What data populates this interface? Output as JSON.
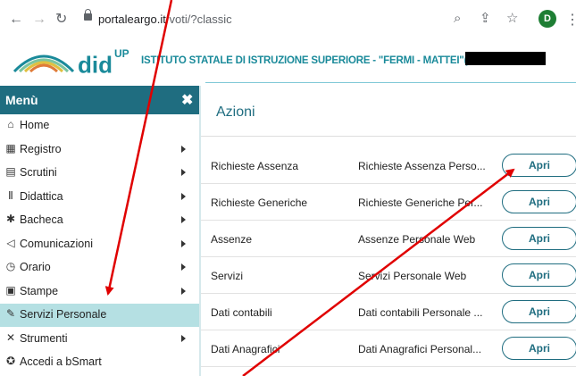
{
  "browser": {
    "url_host": "portaleargo.it",
    "url_path": "/voti/?classic",
    "avatar_letter": "D",
    "icons": [
      "back-arrow-icon",
      "forward-arrow-icon",
      "reload-icon",
      "lock-icon",
      "zoom-icon",
      "share-icon",
      "bookmark-star-icon",
      "kebab-menu-icon"
    ]
  },
  "header": {
    "brand": "did",
    "brand_sup": "UP",
    "school_name": "ISTITUTO STATALE DI ISTRUZIONE SUPERIORE - \"FERMI - MATTEI\"("
  },
  "sidebar": {
    "title": "Menù",
    "close_glyph": "✖",
    "items": [
      {
        "label": "Home",
        "icon": "home-icon",
        "glyph": "⌂",
        "arrow": false,
        "active": false
      },
      {
        "label": "Registro",
        "icon": "calendar-icon",
        "glyph": "▦",
        "arrow": true,
        "active": false
      },
      {
        "label": "Scrutini",
        "icon": "document-icon",
        "glyph": "▤",
        "arrow": true,
        "active": false
      },
      {
        "label": "Didattica",
        "icon": "book-icon",
        "glyph": "Ⅱ",
        "arrow": true,
        "active": false
      },
      {
        "label": "Bacheca",
        "icon": "bulletin-icon",
        "glyph": "✱",
        "arrow": true,
        "active": false
      },
      {
        "label": "Comunicazioni",
        "icon": "send-icon",
        "glyph": "◁",
        "arrow": true,
        "active": false
      },
      {
        "label": "Orario",
        "icon": "clock-icon",
        "glyph": "◷",
        "arrow": true,
        "active": false
      },
      {
        "label": "Stampe",
        "icon": "print-icon",
        "glyph": "▣",
        "arrow": true,
        "active": false
      },
      {
        "label": "Servizi Personale",
        "icon": "edit-icon",
        "glyph": "✎",
        "arrow": false,
        "active": true
      },
      {
        "label": "Strumenti",
        "icon": "tools-icon",
        "glyph": "✕",
        "arrow": true,
        "active": false
      },
      {
        "label": "Accedi a bSmart",
        "icon": "bsmart-icon",
        "glyph": "✪",
        "arrow": false,
        "active": false
      }
    ]
  },
  "main": {
    "title": "Azioni",
    "rows": [
      {
        "name": "Richieste Assenza",
        "desc": "Richieste Assenza Perso...",
        "button": "Apri"
      },
      {
        "name": "Richieste Generiche",
        "desc": "Richieste Generiche Per...",
        "button": "Apri"
      },
      {
        "name": "Assenze",
        "desc": "Assenze Personale Web",
        "button": "Apri"
      },
      {
        "name": "Servizi",
        "desc": "Servizi Personale Web",
        "button": "Apri"
      },
      {
        "name": "Dati contabili",
        "desc": "Dati contabili Personale ...",
        "button": "Apri"
      },
      {
        "name": "Dati Anagrafici",
        "desc": "Dati Anagrafici Personal...",
        "button": "Apri"
      }
    ]
  },
  "colors": {
    "accent": "#1f6d80",
    "brand": "#1a8a9a",
    "active_item": "#b5e0e3",
    "annotation_arrow": "#e00000"
  }
}
